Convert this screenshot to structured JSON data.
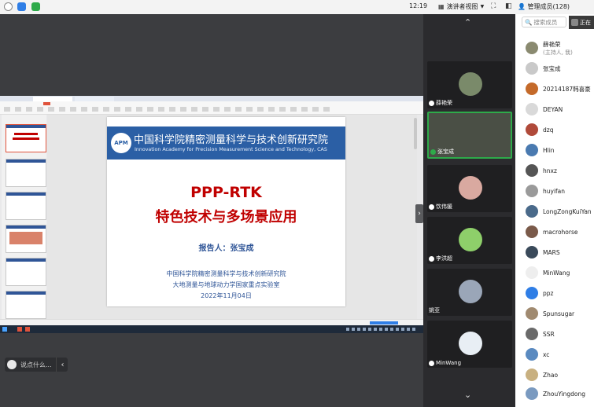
{
  "topbar": {
    "time": "12:19",
    "view_label": "演讲者视图",
    "members_label": "管理成员(128)"
  },
  "slide": {
    "logo_text": "APM",
    "institute_cn": "中国科学院精密测量科学与技术创新研究院",
    "institute_en": "Innovation Academy for Precision Measurement Science and Technology, CAS",
    "title_line1": "PPP-RTK",
    "title_line2": "特色技术与多场景应用",
    "reporter": "报告人：张宝成",
    "org1": "中国科学院精密测量科学与技术创新研究院",
    "org2": "大地测量与地球动力学国家重点实验室",
    "date": "2022年11月04日"
  },
  "chat": {
    "placeholder": "说点什么..."
  },
  "videos": [
    {
      "name": "薛艳荣",
      "color": "#7a8a6a"
    },
    {
      "name": "张宝成",
      "color": "#6b7a66"
    },
    {
      "name": "饮伟媛",
      "color": "#d9a9a0"
    },
    {
      "name": "李洪超",
      "color": "#8ecf6a"
    },
    {
      "name": "姚亚",
      "color": "#9aa6b8"
    },
    {
      "name": "MinWang",
      "color": "#e8eef4"
    }
  ],
  "members": {
    "search_placeholder": "搜索成员",
    "talking_label": "正在",
    "list": [
      {
        "name": "薛艳荣",
        "sub": "(主持人, 我)",
        "color": "#8a8a70"
      },
      {
        "name": "张宝成",
        "sub": "",
        "color": "#c9c9c9"
      },
      {
        "name": "20214187韩喜豪",
        "sub": "",
        "color": "#c46a2a"
      },
      {
        "name": "DEYAN",
        "sub": "",
        "color": "#d9d9d9"
      },
      {
        "name": "dzq",
        "sub": "",
        "color": "#b04a3a"
      },
      {
        "name": "Hlin",
        "sub": "",
        "color": "#4a7ab0"
      },
      {
        "name": "hnxz",
        "sub": "",
        "color": "#555555"
      },
      {
        "name": "huyifan",
        "sub": "",
        "color": "#9a9a9a"
      },
      {
        "name": "LongZongKuiYan",
        "sub": "",
        "color": "#4a6a8a"
      },
      {
        "name": "macrohorse",
        "sub": "",
        "color": "#7a5a4a"
      },
      {
        "name": "MARS",
        "sub": "",
        "color": "#3a4a5a"
      },
      {
        "name": "MinWang",
        "sub": "",
        "color": "#eeeeee"
      },
      {
        "name": "ppz",
        "sub": "",
        "color": "#2f7ee6"
      },
      {
        "name": "Spunsugar",
        "sub": "",
        "color": "#a08a70"
      },
      {
        "name": "SSR",
        "sub": "",
        "color": "#6a6a6a"
      },
      {
        "name": "xc",
        "sub": "",
        "color": "#5a8ac0"
      },
      {
        "name": "Zhao",
        "sub": "",
        "color": "#c8b080"
      },
      {
        "name": "ZhouYingdong",
        "sub": "",
        "color": "#7a9ac0"
      }
    ]
  },
  "colors": {
    "accent_red": "#c00000",
    "accent_blue": "#2f5597",
    "banner_blue": "#2b5fa5"
  }
}
